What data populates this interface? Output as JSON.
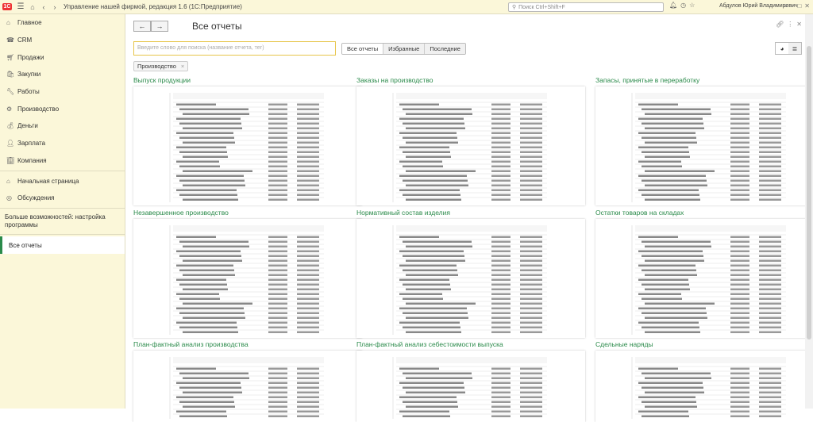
{
  "app": {
    "title": "Управление нашей фирмой, редакция 1.6  (1С:Предприятие)",
    "logo": "1С",
    "search_placeholder": "Поиск Ctrl+Shift+F",
    "user": "Абдулов Юрий Владимирович"
  },
  "sidebar": {
    "sections": [
      "Главное",
      "CRM",
      "Продажи",
      "Закупки",
      "Работы",
      "Производство",
      "Деньги",
      "Зарплата",
      "Компания"
    ],
    "icons": [
      "home-icon",
      "crm-icon",
      "sales-icon",
      "purchases-icon",
      "works-icon",
      "production-icon",
      "money-icon",
      "salary-icon",
      "company-icon"
    ],
    "links": [
      "Начальная страница",
      "Обсуждения"
    ],
    "more": "Больше возможностей: настройка программы",
    "active": "Все отчеты"
  },
  "page": {
    "title": "Все отчеты",
    "back_icon": "←",
    "forward_icon": "→",
    "search_placeholder": "Введите слово для поиска (название отчета, тег)",
    "tabs": [
      "Все отчеты",
      "Избранные",
      "Последние"
    ],
    "filter_tag": "Производство",
    "filter_close": "×"
  },
  "reports": [
    {
      "title": "Выпуск продукции"
    },
    {
      "title": "Заказы на производство"
    },
    {
      "title": "Запасы, принятые в переработку"
    },
    {
      "title": "Незавершенное производство"
    },
    {
      "title": "Нормативный состав изделия"
    },
    {
      "title": "Остатки товаров на складах"
    },
    {
      "title": "План-фактный анализ производства"
    },
    {
      "title": "План-фактный анализ себестоимости выпуска"
    },
    {
      "title": "Сдельные наряды"
    }
  ]
}
